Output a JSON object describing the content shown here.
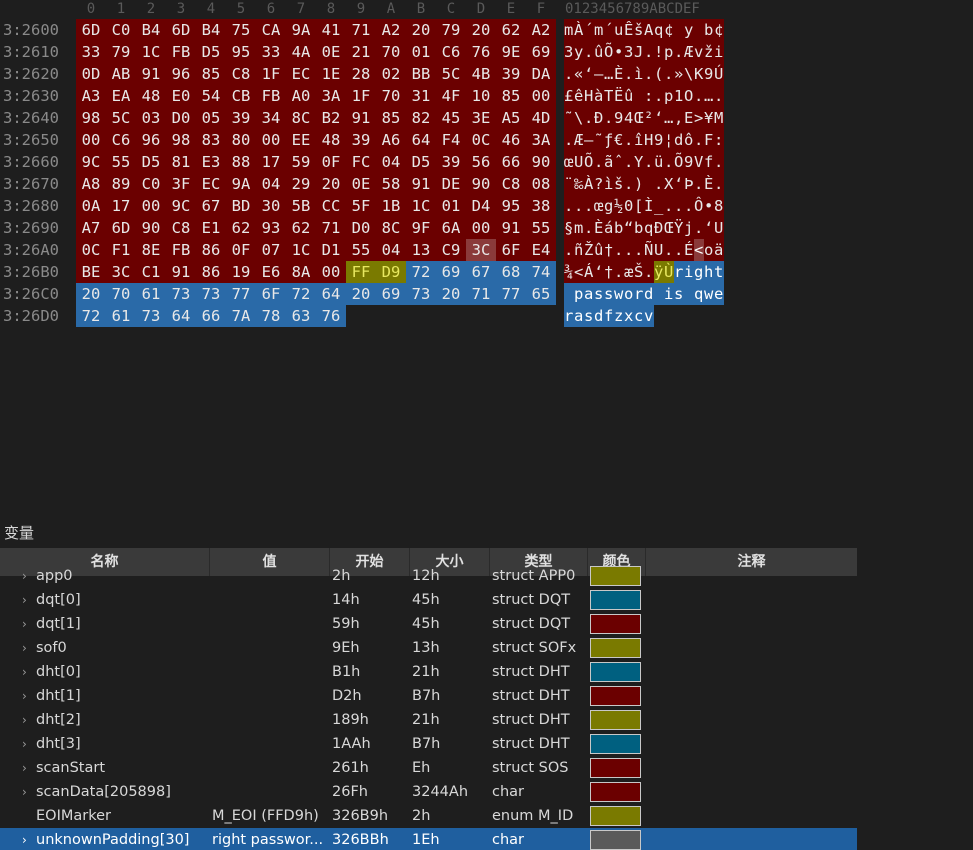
{
  "hex": {
    "column_headers": [
      "0",
      "1",
      "2",
      "3",
      "4",
      "5",
      "6",
      "7",
      "8",
      "9",
      "A",
      "B",
      "C",
      "D",
      "E",
      "F"
    ],
    "ascii_header": "0123456789ABCDEF",
    "rows": [
      {
        "addr": "3:2600",
        "bytes": [
          "6D",
          "C0",
          "B4",
          "6D",
          "B4",
          "75",
          "CA",
          "9A",
          "41",
          "71",
          "A2",
          "20",
          "79",
          "20",
          "62",
          "A2"
        ],
        "ascii": "mÀ´m´uÊšAq¢ y b¢"
      },
      {
        "addr": "3:2610",
        "bytes": [
          "33",
          "79",
          "1C",
          "FB",
          "D5",
          "95",
          "33",
          "4A",
          "0E",
          "21",
          "70",
          "01",
          "C6",
          "76",
          "9E",
          "69"
        ],
        "ascii": "3y.ûÕ•3J.!p.Ævži"
      },
      {
        "addr": "3:2620",
        "bytes": [
          "0D",
          "AB",
          "91",
          "96",
          "85",
          "C8",
          "1F",
          "EC",
          "1E",
          "28",
          "02",
          "BB",
          "5C",
          "4B",
          "39",
          "DA"
        ],
        "ascii": ".«‘–…È.ì.(.»\\K9Ú"
      },
      {
        "addr": "3:2630",
        "bytes": [
          "A3",
          "EA",
          "48",
          "E0",
          "54",
          "CB",
          "FB",
          "A0",
          "3A",
          "1F",
          "70",
          "31",
          "4F",
          "10",
          "85",
          "00"
        ],
        "ascii": "£êHàTËû :.p1O.…."
      },
      {
        "addr": "3:2640",
        "bytes": [
          "98",
          "5C",
          "03",
          "D0",
          "05",
          "39",
          "34",
          "8C",
          "B2",
          "91",
          "85",
          "82",
          "45",
          "3E",
          "A5",
          "4D"
        ],
        "ascii": "˜\\.Ð.94Œ²‘…‚E>¥M"
      },
      {
        "addr": "3:2650",
        "bytes": [
          "00",
          "C6",
          "96",
          "98",
          "83",
          "80",
          "00",
          "EE",
          "48",
          "39",
          "A6",
          "64",
          "F4",
          "0C",
          "46",
          "3A"
        ],
        "ascii": ".Æ–˜ƒ€.îH9¦dô.F:"
      },
      {
        "addr": "3:2660",
        "bytes": [
          "9C",
          "55",
          "D5",
          "81",
          "E3",
          "88",
          "17",
          "59",
          "0F",
          "FC",
          "04",
          "D5",
          "39",
          "56",
          "66",
          "90"
        ],
        "ascii": "œUÕ.ãˆ.Y.ü.Õ9Vf."
      },
      {
        "addr": "3:2670",
        "bytes": [
          "A8",
          "89",
          "C0",
          "3F",
          "EC",
          "9A",
          "04",
          "29",
          "20",
          "0E",
          "58",
          "91",
          "DE",
          "90",
          "C8",
          "08"
        ],
        "ascii": "¨‰À?ìš.) .X‘Þ.È."
      },
      {
        "addr": "3:2680",
        "bytes": [
          "0A",
          "17",
          "00",
          "9C",
          "67",
          "BD",
          "30",
          "5B",
          "CC",
          "5F",
          "1B",
          "1C",
          "01",
          "D4",
          "95",
          "38"
        ],
        "ascii": "...œg½0[Ì_...Ô•8"
      },
      {
        "addr": "3:2690",
        "bytes": [
          "A7",
          "6D",
          "90",
          "C8",
          "E1",
          "62",
          "93",
          "62",
          "71",
          "D0",
          "8C",
          "9F",
          "6A",
          "00",
          "91",
          "55"
        ],
        "ascii": "§m.Èáb“bqÐŒŸj.‘U"
      },
      {
        "addr": "3:26A0",
        "bytes": [
          "0C",
          "F1",
          "8E",
          "FB",
          "86",
          "0F",
          "07",
          "1C",
          "D1",
          "55",
          "04",
          "13",
          "C9",
          "3C",
          "6F",
          "E4"
        ],
        "ascii": ".ñŽû†...ÑU..É<oä"
      },
      {
        "addr": "3:26B0",
        "bytes": [
          "BE",
          "3C",
          "C1",
          "91",
          "86",
          "19",
          "E6",
          "8A",
          "00",
          "FF",
          "D9",
          "72",
          "69",
          "67",
          "68",
          "74"
        ],
        "ascii": "¾<Á‘†.æŠ.ÿÙright"
      },
      {
        "addr": "3:26C0",
        "bytes": [
          "20",
          "70",
          "61",
          "73",
          "73",
          "77",
          "6F",
          "72",
          "64",
          "20",
          "69",
          "73",
          "20",
          "71",
          "77",
          "65"
        ],
        "ascii": " password is qwe"
      },
      {
        "addr": "3:26D0",
        "bytes": [
          "72",
          "61",
          "73",
          "64",
          "66",
          "7A",
          "78",
          "63",
          "76"
        ],
        "ascii": "rasdfzxcv"
      }
    ]
  },
  "panel": {
    "title": "变量",
    "columns": {
      "name": "名称",
      "value": "值",
      "start": "开始",
      "size": "大小",
      "type": "类型",
      "color": "颜色",
      "comment": "注释"
    },
    "rows": [
      {
        "name": "app0",
        "value": "",
        "start": "2h",
        "size": "12h",
        "type": "struct APP0",
        "color": "#7a7a00",
        "expand": true
      },
      {
        "name": "dqt[0]",
        "value": "",
        "start": "14h",
        "size": "45h",
        "type": "struct DQT",
        "color": "#006080",
        "expand": true
      },
      {
        "name": "dqt[1]",
        "value": "",
        "start": "59h",
        "size": "45h",
        "type": "struct DQT",
        "color": "#6b0000",
        "expand": true
      },
      {
        "name": "sof0",
        "value": "",
        "start": "9Eh",
        "size": "13h",
        "type": "struct SOFx",
        "color": "#7a7a00",
        "expand": true
      },
      {
        "name": "dht[0]",
        "value": "",
        "start": "B1h",
        "size": "21h",
        "type": "struct DHT",
        "color": "#006080",
        "expand": true
      },
      {
        "name": "dht[1]",
        "value": "",
        "start": "D2h",
        "size": "B7h",
        "type": "struct DHT",
        "color": "#6b0000",
        "expand": true
      },
      {
        "name": "dht[2]",
        "value": "",
        "start": "189h",
        "size": "21h",
        "type": "struct DHT",
        "color": "#7a7a00",
        "expand": true
      },
      {
        "name": "dht[3]",
        "value": "",
        "start": "1AAh",
        "size": "B7h",
        "type": "struct DHT",
        "color": "#006080",
        "expand": true
      },
      {
        "name": "scanStart",
        "value": "",
        "start": "261h",
        "size": "Eh",
        "type": "struct SOS",
        "color": "#6b0000",
        "expand": true
      },
      {
        "name": "scanData[205898]",
        "value": "",
        "start": "26Fh",
        "size": "3244Ah",
        "type": "char",
        "color": "#6b0000",
        "expand": true
      },
      {
        "name": "EOIMarker",
        "value": "M_EOI (FFD9h)",
        "start": "326B9h",
        "size": "2h",
        "type": "enum M_ID",
        "color": "#7a7a00",
        "expand": false
      },
      {
        "name": "unknownPadding[30]",
        "value": "right passwor...",
        "start": "326BBh",
        "size": "1Eh",
        "type": "char",
        "color": "#5a5a5a",
        "expand": true,
        "selected": true
      }
    ]
  }
}
